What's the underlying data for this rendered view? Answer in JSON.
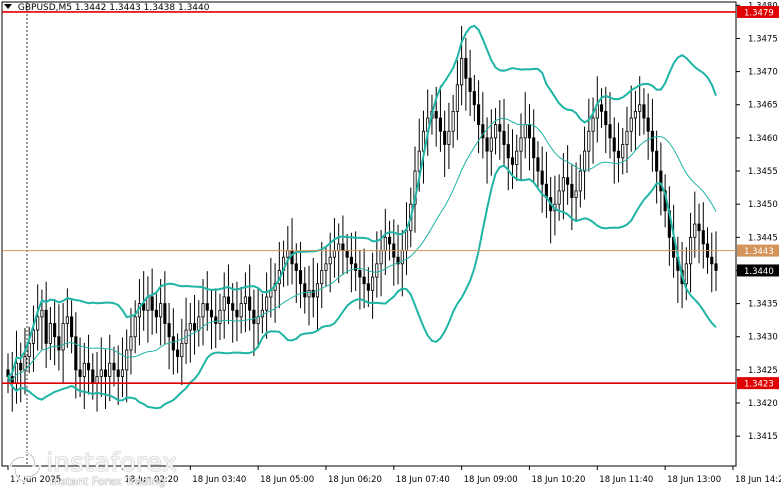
{
  "header": {
    "symbol": "GBPUSD,M5",
    "ohlc": "1.3442 1.3443 1.3438 1.3440"
  },
  "logo": {
    "brand": "instaforex",
    "tagline": "Instant Forex Trading"
  },
  "colors": {
    "candle": "#000000",
    "bollinger": "#1fb5a6",
    "level_line": "#e00000",
    "price_line": "#d4935a",
    "grid_dotted": "#333333"
  },
  "chart_data": {
    "type": "candlestick",
    "symbol": "GBPUSD",
    "timeframe": "M5",
    "y_range": [
      1.34105,
      1.34805
    ],
    "y_ticks": [
      "1.3415",
      "1.3420",
      "1.3425",
      "1.3430",
      "1.3435",
      "1.3440",
      "1.3445",
      "1.3450",
      "1.3455",
      "1.3460",
      "1.3465",
      "1.3470",
      "1.3475",
      "1.3480"
    ],
    "x_ticks": [
      {
        "label": "17 Jun 2025",
        "index": 0
      },
      {
        "label": "18 Jun 02:20",
        "index": 27
      },
      {
        "label": "18 Jun 03:40",
        "index": 43
      },
      {
        "label": "18 Jun 05:00",
        "index": 59
      },
      {
        "label": "18 Jun 06:20",
        "index": 75
      },
      {
        "label": "18 Jun 07:40",
        "index": 91
      },
      {
        "label": "18 Jun 09:00",
        "index": 107
      },
      {
        "label": "18 Jun 10:20",
        "index": 123
      },
      {
        "label": "18 Jun 11:40",
        "index": 139
      },
      {
        "label": "18 Jun 13:00",
        "index": 155
      },
      {
        "label": "18 Jun 14:20",
        "index": 171
      }
    ],
    "closes": [
      1.3424,
      1.3423,
      1.3426,
      1.3425,
      1.3427,
      1.3429,
      1.3431,
      1.3433,
      1.3434,
      1.3429,
      1.3432,
      1.343,
      1.3428,
      1.3432,
      1.3433,
      1.343,
      1.3425,
      1.3424,
      1.3426,
      1.3425,
      1.3423,
      1.3424,
      1.3425,
      1.3424,
      1.3426,
      1.3425,
      1.3424,
      1.3425,
      1.3428,
      1.343,
      1.3433,
      1.3435,
      1.3434,
      1.3436,
      1.3434,
      1.3433,
      1.3435,
      1.3432,
      1.343,
      1.3428,
      1.3427,
      1.3429,
      1.3431,
      1.3432,
      1.3431,
      1.3433,
      1.3435,
      1.3434,
      1.3433,
      1.3432,
      1.3434,
      1.3436,
      1.3435,
      1.3434,
      1.3433,
      1.3435,
      1.3436,
      1.3434,
      1.3432,
      1.3433,
      1.3434,
      1.3436,
      1.3437,
      1.3438,
      1.344,
      1.3442,
      1.3443,
      1.3441,
      1.344,
      1.3438,
      1.3436,
      1.3437,
      1.3436,
      1.3438,
      1.344,
      1.3441,
      1.3442,
      1.3443,
      1.3444,
      1.3443,
      1.3442,
      1.3441,
      1.344,
      1.3439,
      1.3438,
      1.3437,
      1.3439,
      1.3441,
      1.3443,
      1.3445,
      1.3444,
      1.3442,
      1.3441,
      1.3443,
      1.3446,
      1.345,
      1.3455,
      1.3458,
      1.3461,
      1.3463,
      1.3464,
      1.3463,
      1.3461,
      1.3459,
      1.3461,
      1.3464,
      1.3468,
      1.3472,
      1.3469,
      1.3467,
      1.3465,
      1.3462,
      1.346,
      1.3458,
      1.346,
      1.3462,
      1.3461,
      1.3459,
      1.3457,
      1.3456,
      1.3458,
      1.346,
      1.3462,
      1.346,
      1.3457,
      1.3455,
      1.3453,
      1.3451,
      1.3449,
      1.345,
      1.3452,
      1.3454,
      1.3453,
      1.3451,
      1.3452,
      1.3455,
      1.3458,
      1.3461,
      1.3463,
      1.3465,
      1.3464,
      1.3462,
      1.346,
      1.3458,
      1.3457,
      1.3459,
      1.3461,
      1.3463,
      1.3464,
      1.3465,
      1.3463,
      1.3461,
      1.3458,
      1.3455,
      1.3452,
      1.3449,
      1.3445,
      1.3442,
      1.344,
      1.3438,
      1.3441,
      1.3445,
      1.3447,
      1.3446,
      1.3444,
      1.3442,
      1.3441,
      1.344
    ],
    "bollinger_upper_ref": [
      1.343,
      1.3445,
      1.3455,
      1.346,
      1.3445,
      1.3436,
      1.3438,
      1.344,
      1.3441,
      1.3442,
      1.3445,
      1.3447,
      1.345,
      1.347,
      1.3482,
      1.3478
    ],
    "levels": [
      {
        "label": "1.3479",
        "value": 1.3479,
        "color": "#e00000"
      },
      {
        "label": "1.3423",
        "value": 1.3423,
        "color": "#e00000"
      }
    ],
    "current_price": {
      "label": "1.3443",
      "value": 1.3443
    },
    "bid_price": {
      "label": "1.3440",
      "value": 1.344
    }
  }
}
